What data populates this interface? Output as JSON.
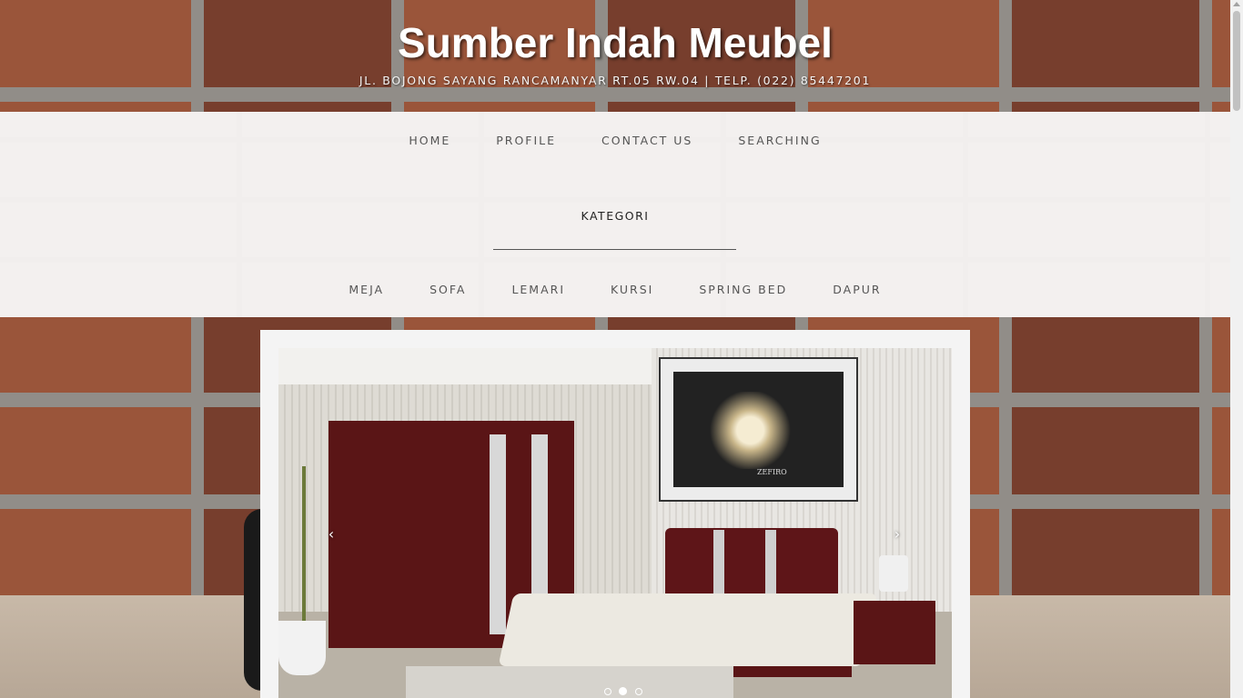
{
  "header": {
    "title": "Sumber Indah Meubel",
    "address": "JL. BOJONG SAYANG RANCAMANYAR RT.05 RW.04 | TELP. (022) 85447201"
  },
  "main_nav": {
    "items": [
      {
        "label": "HOME"
      },
      {
        "label": "PROFILE"
      },
      {
        "label": "CONTACT US"
      },
      {
        "label": "SEARCHING"
      }
    ]
  },
  "categories": {
    "heading": "KATEGORI",
    "items": [
      {
        "label": "MEJA"
      },
      {
        "label": "SOFA"
      },
      {
        "label": "LEMARI"
      },
      {
        "label": "KURSI"
      },
      {
        "label": "SPRING BED"
      },
      {
        "label": "DAPUR"
      }
    ]
  },
  "slider": {
    "prev_icon": "‹",
    "next_icon": "›",
    "artwork_caption": "ZEFIRO",
    "slide_count": 3,
    "active_slide": 2
  },
  "colors": {
    "title_text": "#ffffff",
    "nav_text": "#555555",
    "nav_panel_bg": "#f2eeec",
    "slider_frame_bg": "#f4f4f4"
  }
}
